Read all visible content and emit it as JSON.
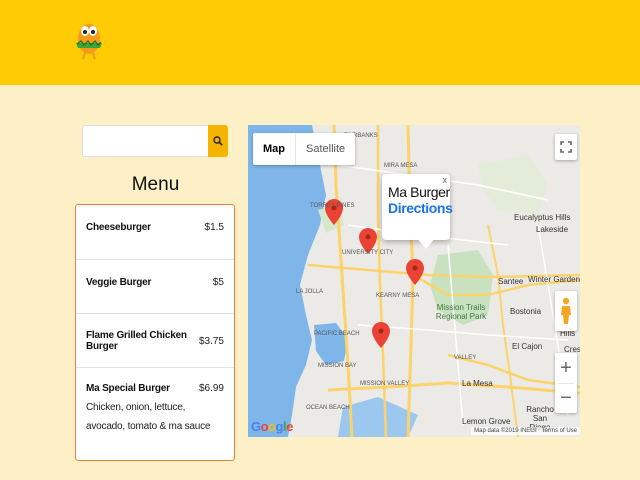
{
  "header": {
    "logo_icon": "orange-mascot-logo"
  },
  "search": {
    "value": "",
    "placeholder": "",
    "icon": "search-icon"
  },
  "menu": {
    "title": "Menu",
    "items": [
      {
        "name": "Cheeseburger",
        "price": "$1.5",
        "description": ""
      },
      {
        "name": "Veggie Burger",
        "price": "$5",
        "description": ""
      },
      {
        "name": "Flame Grilled Chicken Burger",
        "price": "$3.75",
        "description": ""
      },
      {
        "name": "Ma Special Burger",
        "price": "$6.99",
        "description": "Chicken, onion, lettuce, avocado, tomato & ma sauce"
      }
    ]
  },
  "map": {
    "type_map": "Map",
    "type_satellite": "Satellite",
    "selected_type": "Map",
    "info_window": {
      "title": "Ma Burger",
      "link": "Directions",
      "close": "x"
    },
    "zoom_in": "+",
    "zoom_out": "−",
    "attribution": "Map data ©2019 INEGI",
    "terms": "Terms of Use",
    "logo_letters": [
      "G",
      "o",
      "o",
      "g",
      "l",
      "e"
    ],
    "place_labels": {
      "mira_mesa": "MIRA MESA",
      "fairbanks": "FAIRBANKS",
      "torrey_pines": "TORREY PINES",
      "university_city": "UNIVERSITY CITY",
      "eucalyptus_hills": "Eucalyptus Hills",
      "lakeside": "Lakeside",
      "santee": "Santee",
      "winter_gardens": "Winter Gardens",
      "la_jolla": "LA JOLLA",
      "kearny_mesa": "KEARNY MESA",
      "mission_trails": "Mission Trails Regional Park",
      "bostonia": "Bostonia",
      "el_cajon": "El Cajon",
      "crest": "Crest",
      "pacific_beach": "PACIFIC BEACH",
      "mission_bay": "MISSION BAY",
      "mission_valley": "MISSION VALLEY",
      "la_mesa": "La Mesa",
      "ocean_beach": "OCEAN BEACH",
      "rancho_san_diego": "Rancho San Diego",
      "lemon_grove": "Lemon Grove",
      "valley": "VALLEY",
      "hills": "Hills"
    },
    "marker_count": 4,
    "colors": {
      "marker": "#ea4335",
      "water": "#7fb6ea",
      "park": "#c8e1bf",
      "highway": "#fcd36b"
    }
  },
  "colors": {
    "header": "#ffcb05",
    "background": "#fdf0c6",
    "search_button": "#f4b400",
    "menu_border": "#e8823a"
  }
}
